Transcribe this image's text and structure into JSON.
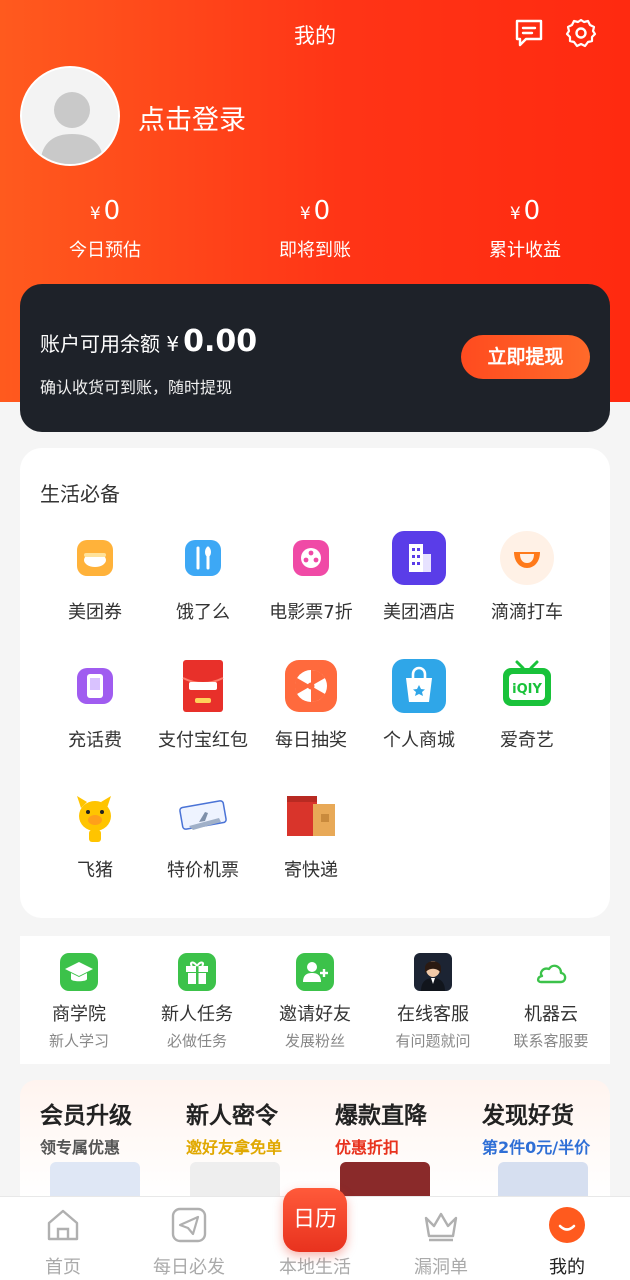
{
  "header": {
    "title": "我的",
    "message_icon": "message-icon",
    "settings_icon": "gear-icon",
    "login_label": "点击登录"
  },
  "stats": [
    {
      "currency": "¥",
      "value": "0",
      "label": "今日预估"
    },
    {
      "currency": "¥",
      "value": "0",
      "label": "即将到账"
    },
    {
      "currency": "¥",
      "value": "0",
      "label": "累计收益"
    }
  ],
  "balance": {
    "label": "账户可用余额",
    "currency": "¥",
    "amount": "0.00",
    "note": "确认收货可到账，随时提现",
    "withdraw_label": "立即提现"
  },
  "life": {
    "title": "生活必备",
    "items": [
      {
        "label": "美团券",
        "icon": "meituan-coupon-icon"
      },
      {
        "label": "饿了么",
        "icon": "eleme-icon"
      },
      {
        "label": "电影票7折",
        "icon": "movie-ticket-icon"
      },
      {
        "label": "美团酒店",
        "icon": "hotel-icon"
      },
      {
        "label": "滴滴打车",
        "icon": "didi-icon"
      },
      {
        "label": "充话费",
        "icon": "phone-recharge-icon"
      },
      {
        "label": "支付宝红包",
        "icon": "alipay-red-packet-icon"
      },
      {
        "label": "每日抽奖",
        "icon": "lottery-wheel-icon"
      },
      {
        "label": "个人商城",
        "icon": "shop-bag-icon"
      },
      {
        "label": "爱奇艺",
        "icon": "iqiyi-icon"
      },
      {
        "label": "飞猪",
        "icon": "fliggy-icon"
      },
      {
        "label": "特价机票",
        "icon": "air-ticket-icon"
      },
      {
        "label": "寄快递",
        "icon": "express-box-icon"
      }
    ]
  },
  "tools": [
    {
      "title": "商学院",
      "sub": "新人学习",
      "icon": "graduation-cap-icon"
    },
    {
      "title": "新人任务",
      "sub": "必做任务",
      "icon": "gift-icon"
    },
    {
      "title": "邀请好友",
      "sub": "发展粉丝",
      "icon": "invite-user-icon"
    },
    {
      "title": "在线客服",
      "sub": "有问题就问",
      "icon": "customer-service-avatar"
    },
    {
      "title": "机器云",
      "sub": "联系客服要",
      "icon": "cloud-icon"
    }
  ],
  "promos": [
    {
      "title": "会员升级",
      "sub": "领专属优惠",
      "sub_color": "#555555"
    },
    {
      "title": "新人密令",
      "sub": "邀好友拿免单",
      "sub_color": "#e0a800"
    },
    {
      "title": "爆款直降",
      "sub": "优惠折扣",
      "sub_color": "#e8321e"
    },
    {
      "title": "发现好货",
      "sub": "第2件0元/半价",
      "sub_color": "#2f6fd6"
    }
  ],
  "tabbar": [
    {
      "label": "首页",
      "icon": "home-icon"
    },
    {
      "label": "每日必发",
      "icon": "send-icon"
    },
    {
      "label": "本地生活",
      "icon": "calendar-icon",
      "badge": "日历"
    },
    {
      "label": "漏洞单",
      "icon": "crown-icon"
    },
    {
      "label": "我的",
      "icon": "smile-icon",
      "active": true
    }
  ],
  "colors": {
    "brand_orange": "#ff4a1c",
    "dark_card": "#1e2229",
    "active_tab": "#ff5a1e"
  }
}
